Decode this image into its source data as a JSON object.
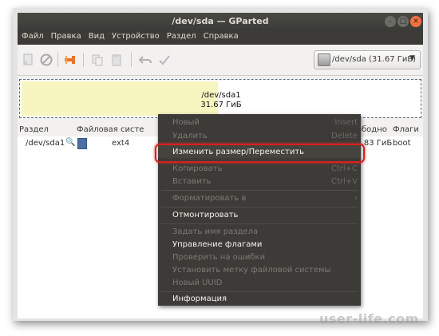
{
  "window": {
    "title": "/dev/sda — GParted"
  },
  "menubar": {
    "items": [
      "Файл",
      "Правка",
      "Вид",
      "Устройство",
      "Раздел",
      "Справка"
    ]
  },
  "toolbar": {
    "icons": [
      "new-partition-icon",
      "delete-icon",
      "resize-move-icon",
      "copy-icon",
      "paste-icon",
      "undo-icon",
      "apply-icon"
    ],
    "device_selector": "/dev/sda   (31.67 ГиБ)"
  },
  "disk_graphic": {
    "partition_name": "/dev/sda1",
    "partition_size": "31.67 ГиБ"
  },
  "table": {
    "headers": {
      "partition": "Раздел",
      "filesystem": "Файловая систе",
      "free": "Свободно",
      "flags": "Флаги"
    },
    "row": {
      "partition": "/dev/sda1",
      "filesystem": "ext4",
      "free": "15.83 ГиБ",
      "flags": "boot"
    }
  },
  "context_menu": {
    "new": "Новый",
    "new_shortcut": "Insert",
    "delete": "Удалить",
    "delete_shortcut": "Delete",
    "resize_move": "Изменить размер/Переместить",
    "copy": "Копировать",
    "copy_shortcut": "Ctrl+C",
    "paste": "Вставить",
    "paste_shortcut": "Ctrl+V",
    "format_to": "Форматировать в",
    "unmount": "Отмонтировать",
    "set_label": "Задать имя раздела",
    "manage_flags": "Управление флагами",
    "check": "Проверить на ошибки",
    "set_fs_label": "Установить метку файловой системы",
    "new_uuid": "Новый UUID",
    "information": "Информация"
  },
  "watermark": "user-life.com",
  "colors": {
    "titlebar": "#3c3b37",
    "menu_bg": "#3c3b37",
    "partition_fill": "#f8f6c0",
    "ext4_swatch": "#4a6fa4",
    "highlight_outline": "#d8201d",
    "close_button": "#f0733f"
  }
}
